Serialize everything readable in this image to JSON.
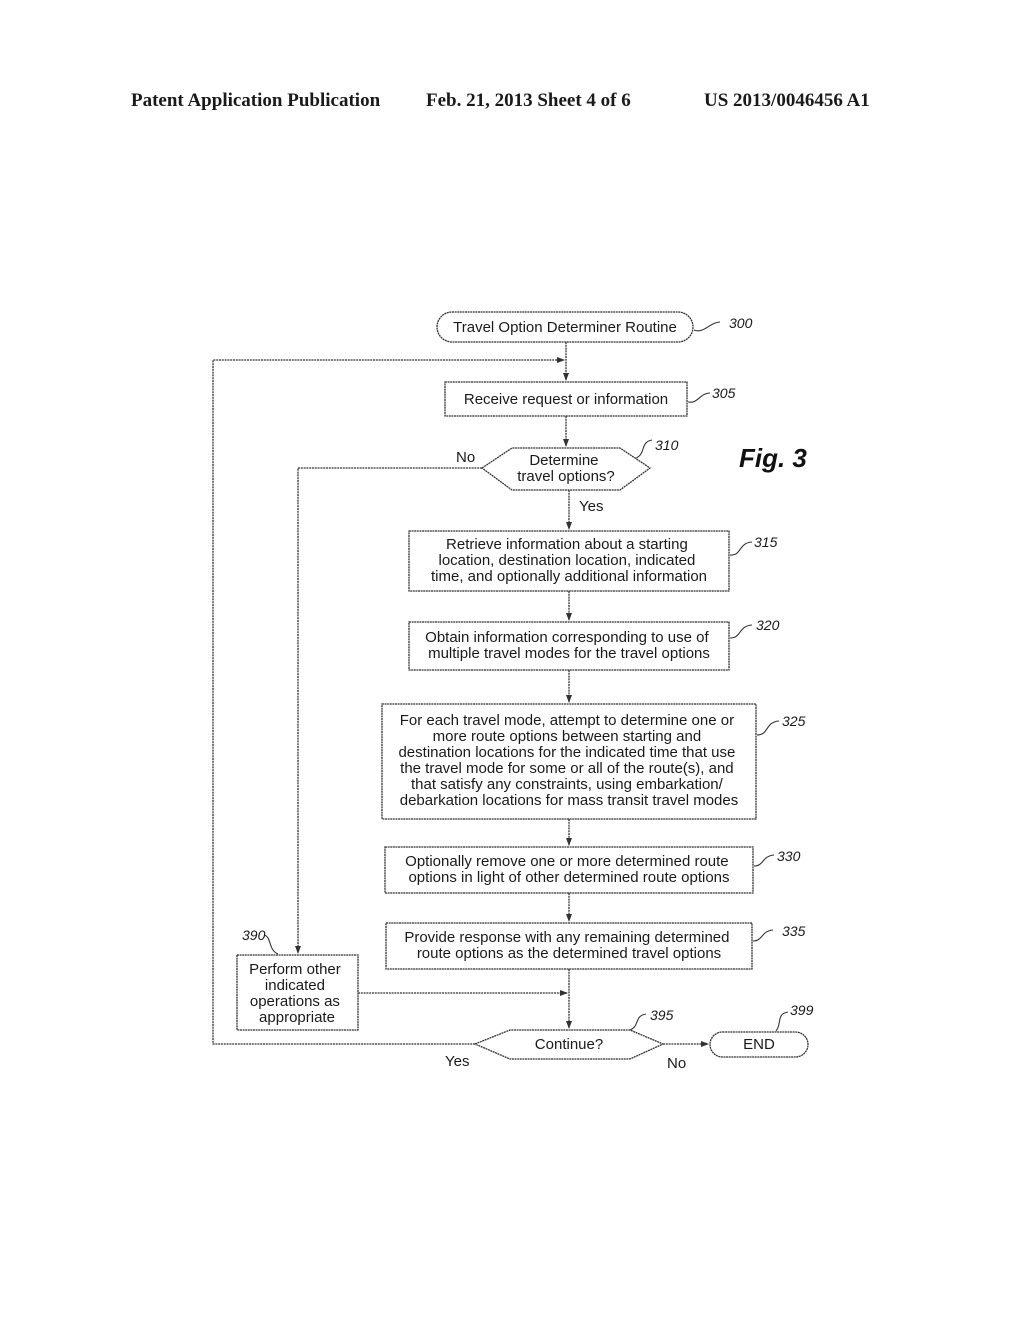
{
  "header": {
    "left": "Patent Application Publication",
    "middle": "Feb. 21, 2013   Sheet 4 of 6",
    "right": "US 2013/0046456 A1"
  },
  "figure_label": "Fig. 3",
  "nodes": {
    "start": {
      "ref": "300",
      "lines": [
        "Travel Option Determiner Routine"
      ]
    },
    "n305": {
      "ref": "305",
      "lines": [
        "Receive request or information"
      ]
    },
    "n310": {
      "ref": "310",
      "lines": [
        "Determine",
        "travel options?"
      ]
    },
    "n315": {
      "ref": "315",
      "lines": [
        "Retrieve information about a starting",
        "location, destination location, indicated",
        "time, and optionally additional information"
      ]
    },
    "n320": {
      "ref": "320",
      "lines": [
        "Obtain information corresponding to use of",
        "multiple travel modes for the travel options"
      ]
    },
    "n325": {
      "ref": "325",
      "lines": [
        "For each travel mode, attempt to determine one or",
        "more route options between starting and",
        "destination locations for the indicated time that use",
        "the travel mode for some or all of the route(s), and",
        "that satisfy any constraints, using embarkation/",
        "debarkation locations for mass transit travel modes"
      ]
    },
    "n330": {
      "ref": "330",
      "lines": [
        "Optionally remove one or more determined route",
        "options in light of other determined route options"
      ]
    },
    "n335": {
      "ref": "335",
      "lines": [
        "Provide response with any remaining determined",
        "route options as the determined travel options"
      ]
    },
    "n390": {
      "ref": "390",
      "lines": [
        "Perform other",
        "indicated",
        "operations as",
        "appropriate"
      ]
    },
    "n395": {
      "ref": "395",
      "lines": [
        "Continue?"
      ]
    },
    "end": {
      "ref": "399",
      "lines": [
        "END"
      ]
    }
  },
  "edge_labels": {
    "n310_no": "No",
    "n310_yes": "Yes",
    "n395_yes": "Yes",
    "n395_no": "No"
  }
}
